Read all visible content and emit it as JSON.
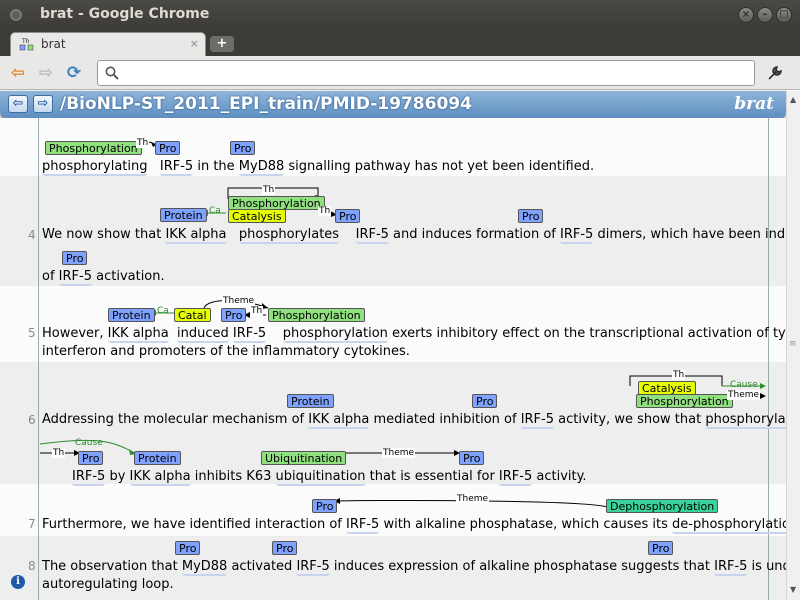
{
  "window": {
    "title": "brat - Google Chrome"
  },
  "tab": {
    "title": "brat",
    "close": "×",
    "new_tab": "+"
  },
  "toolbar": {
    "back": "⇦",
    "forward": "⇨",
    "reload": "⟳",
    "address_value": "",
    "menu_icon": "wrench-icon"
  },
  "brat": {
    "doc_path": "/BioNLP-ST_2011_EPI_train/PMID-19786094",
    "logo": "brat",
    "prev": "⇦",
    "next": "⇨"
  },
  "colors": {
    "protein": "#7fa2ff",
    "phosphorylation": "#90e080",
    "catalysis": "#e6ff00",
    "dephosphorylation": "#3ad39c",
    "cause_arc": "#2a8c2a"
  },
  "sentences": [
    {
      "num": "",
      "lines": [
        {
          "pre": "",
          "t1": "phosphorylating",
          "m1": " ",
          "t2": "IRF-5",
          "m2": " in the ",
          "t3": "MyD88",
          "post": " signalling pathway has not yet been identified."
        }
      ],
      "labels": {
        "a": "Phosphorylation",
        "b": "Pro",
        "c": "Pro",
        "arc1": "Th"
      }
    },
    {
      "num": "4",
      "line1": {
        "a": "We now show that ",
        "b": "IKK alpha",
        "c": "phosphorylates",
        "d": "IRF-5",
        "e": " and induces formation of ",
        "f": "IRF-5",
        "g": " dimers, which have been indicative"
      },
      "line2": {
        "a": "of ",
        "b": "IRF-5",
        "c": " activation."
      },
      "labels": {
        "protein": "Protein",
        "phos": "Phosphorylation",
        "cat": "Catalysis",
        "pro1": "Pro",
        "pro2": "Pro",
        "pro3": "Pro",
        "arc_th_top": "Th",
        "arc_ca": "Ca",
        "arc_th": "Th"
      }
    },
    {
      "num": "5",
      "line1": {
        "a": "However, ",
        "b": "IKK alpha",
        "c": "induced",
        "d": "IRF-5",
        "e": "phosphorylation",
        "f": " exerts inhibitory effect on the transcriptional activation of type 1"
      },
      "line2": {
        "a": "interferon and promoters of the inflammatory cytokines."
      },
      "labels": {
        "protein": "Protein",
        "cat": "Catal",
        "pro": "Pro",
        "phos": "Phosphorylation",
        "arc_theme": "Theme",
        "arc_ca": "Ca",
        "arc_th": "Th"
      }
    },
    {
      "num": "6",
      "line1": {
        "a": "Addressing the molecular mechanism of ",
        "b": "IKK alpha",
        "c": " mediated inhibition of ",
        "d": "IRF-5",
        "e": " activity, we show that ",
        "f": "phosphorylation",
        "g": " of"
      },
      "line2": {
        "a": "IRF-5",
        "b": " by ",
        "c": "IKK alpha",
        "d": " inhibits K63 ",
        "e": "ubiquitination",
        "f": " that is essential for ",
        "g": "IRF-5",
        "h": " activity."
      },
      "labels": {
        "protein1": "Protein",
        "pro1": "Pro",
        "cat": "Catalysis",
        "phos": "Phosphorylation",
        "arc_th": "Th",
        "arc_cause": "Cause",
        "arc_theme": "Theme",
        "pro2": "Pro",
        "protein2": "Protein",
        "ubi": "Ubiquitination",
        "pro3": "Pro",
        "arc_cause2": "Cause",
        "arc_th2": "Th",
        "arc_theme2": "Theme"
      }
    },
    {
      "num": "7",
      "line1": {
        "a": "Furthermore, we have identified interaction of ",
        "b": "IRF-5",
        "c": " with alkaline phosphatase, which causes its ",
        "d": "de-phosphorylation",
        "e": "."
      },
      "labels": {
        "pro": "Pro",
        "dephos": "Dephosphorylation",
        "arc_theme": "Theme"
      }
    },
    {
      "num": "8",
      "line1": {
        "a": "The observation that ",
        "b": "MyD88",
        "c": " activated ",
        "d": "IRF-5",
        "e": " induces expression of alkaline phosphatase suggests that ",
        "f": "IRF-5",
        "g": " is under"
      },
      "line2": {
        "a": "autoregulating loop."
      },
      "labels": {
        "pro1": "Pro",
        "pro2": "Pro",
        "pro3": "Pro"
      }
    }
  ],
  "info_icon": "i"
}
